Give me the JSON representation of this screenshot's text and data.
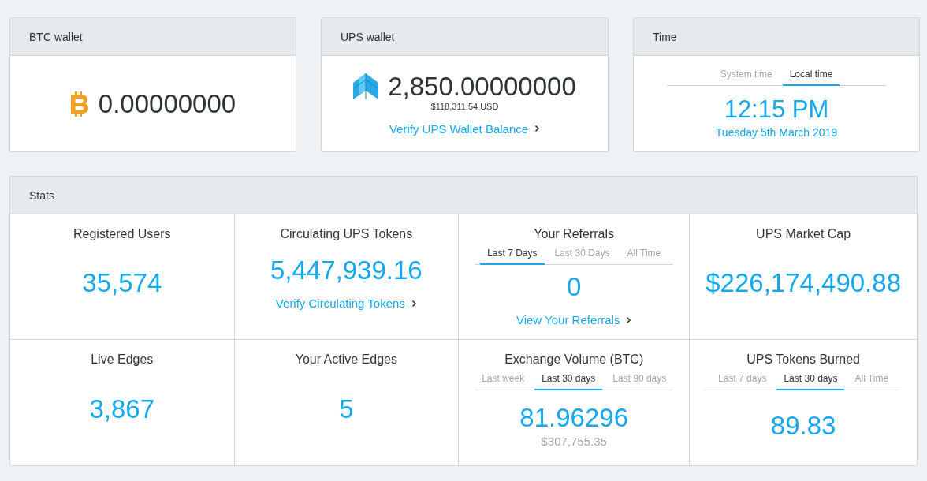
{
  "wallets": [
    {
      "title": "BTC wallet",
      "kind": "btc",
      "amount": "0.00000000"
    },
    {
      "title": "UPS wallet",
      "kind": "ups",
      "amount": "2,850.00000000",
      "fiat": "$118,311.54 USD",
      "link": "Verify UPS Wallet Balance"
    }
  ],
  "time": {
    "title": "Time",
    "tabs": [
      {
        "label": "System time",
        "selected": false
      },
      {
        "label": "Local time",
        "selected": true
      }
    ],
    "clock": "12:15 PM",
    "date": "Tuesday 5th March 2019"
  },
  "stats": {
    "title": "Stats",
    "cells": [
      {
        "label": "Registered Users",
        "value": "35,574"
      },
      {
        "label": "Circulating UPS Tokens",
        "value": "5,447,939.16",
        "link": "Verify Circulating Tokens"
      },
      {
        "label": "Your Referrals",
        "tabs": [
          {
            "label": "Last 7 Days",
            "selected": true
          },
          {
            "label": "Last 30 Days",
            "selected": false
          },
          {
            "label": "All Time",
            "selected": false
          }
        ],
        "value": "0",
        "link": "View Your Referrals"
      },
      {
        "label": "UPS Market Cap",
        "value": "$226,174,490.88"
      },
      {
        "label": "Live Edges",
        "value": "3,867"
      },
      {
        "label": "Your Active Edges",
        "value": "5"
      },
      {
        "label": "Exchange Volume (BTC)",
        "tabs": [
          {
            "label": "Last week",
            "selected": false
          },
          {
            "label": "Last 30 days",
            "selected": true
          },
          {
            "label": "Last 90 days",
            "selected": false
          }
        ],
        "value": "81.96296",
        "sub": "$307,755.35"
      },
      {
        "label": "UPS Tokens Burned",
        "tabs": [
          {
            "label": "Last 7 days",
            "selected": false
          },
          {
            "label": "Last 30 days",
            "selected": true
          },
          {
            "label": "All Time",
            "selected": false
          }
        ],
        "value": "89.83"
      }
    ]
  }
}
